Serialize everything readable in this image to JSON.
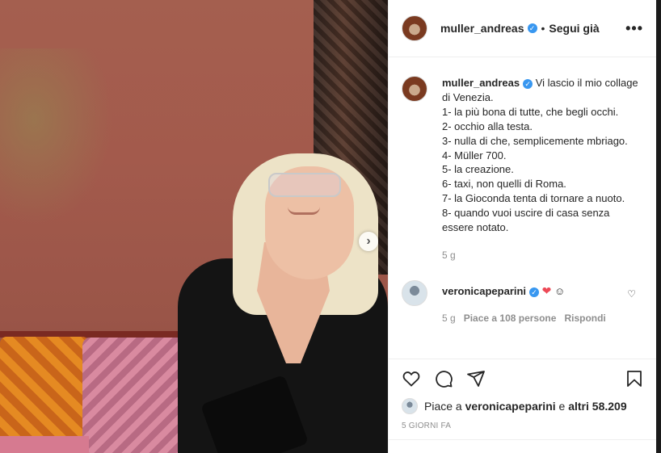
{
  "post": {
    "username": "muller_andreas",
    "follow_label": "Segui già",
    "dot": "•",
    "more": "•••"
  },
  "caption": {
    "username": "muller_andreas",
    "text": "Vi lascio il mio collage di Venezia.",
    "lines": [
      "1- la più bona di tutte, che begli occhi.",
      "2- occhio alla testa.",
      "3- nulla di che, semplicemente mbriago.",
      "4- Müller 700.",
      "5- la creazione.",
      "6- taxi, non quelli di Roma.",
      "7- la Gioconda tenta di tornare a nuoto.",
      "8- quando vuoi uscire di casa senza essere notato."
    ],
    "time": "5 g"
  },
  "comment": {
    "username": "veronicapeparini",
    "text_emoji_heart": "❤",
    "text_emoji_smile": "☺",
    "time": "5 g",
    "likes": "Piace a 108 persone",
    "reply": "Rispondi"
  },
  "likes": {
    "prefix": "Piace a",
    "user": "veronicapeparini",
    "middle": "e",
    "others": "altri 58.209"
  },
  "posted_ago": "5 GIORNI FA",
  "icons": {
    "verified": "verified-badge-icon",
    "like": "heart-icon",
    "comment": "comment-icon",
    "share": "share-icon",
    "save": "bookmark-icon",
    "next": "chevron-right-icon"
  },
  "colors": {
    "verified": "#3897f0",
    "heart": "#ed4956",
    "text": "#262626",
    "muted": "#8e8e8e"
  }
}
